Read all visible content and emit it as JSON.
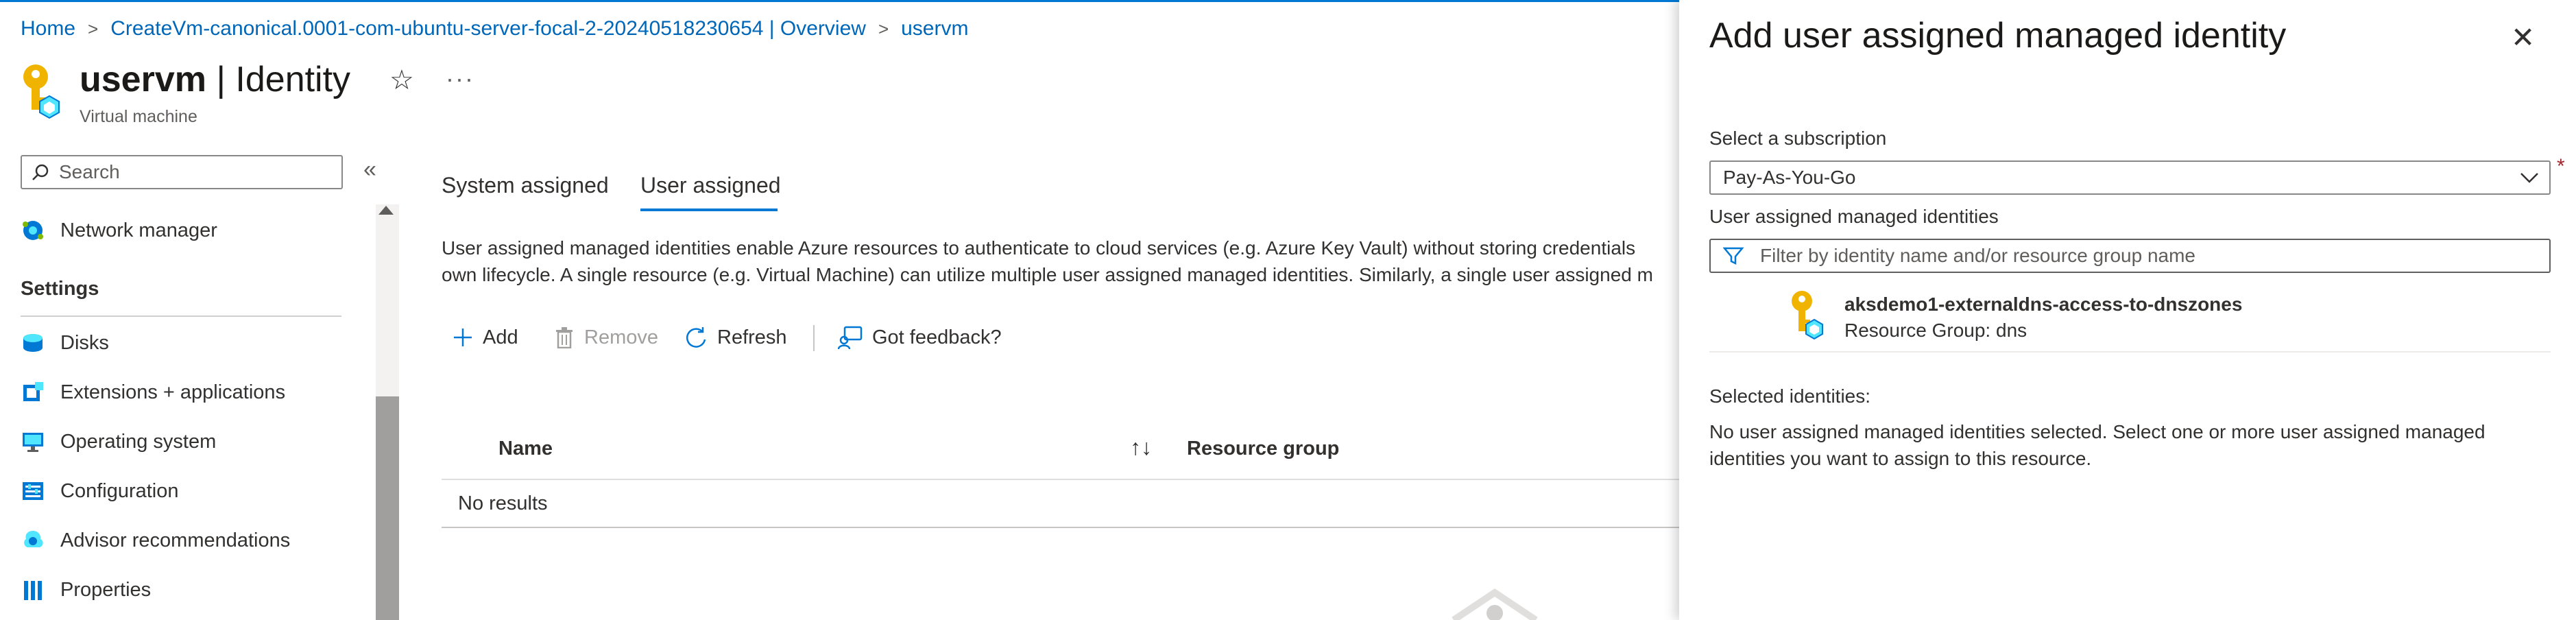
{
  "breadcrumb": [
    "Home",
    "CreateVm-canonical.0001-com-ubuntu-server-focal-2-20240518230654 | Overview",
    "uservm"
  ],
  "header": {
    "resource_name": "uservm",
    "separator": " | ",
    "blade_name": "Identity",
    "subtitle": "Virtual machine",
    "favorite_icon": "star-icon",
    "more_icon": "ellipsis-icon"
  },
  "sidebar": {
    "search_placeholder": "Search",
    "collapse_icon": "double-chevron-left-icon",
    "top_item": {
      "label": "Network manager",
      "icon": "network-manager-icon"
    },
    "section_heading": "Settings",
    "items": [
      {
        "label": "Disks",
        "icon": "disks-icon"
      },
      {
        "label": "Extensions + applications",
        "icon": "extensions-icon"
      },
      {
        "label": "Operating system",
        "icon": "monitor-icon"
      },
      {
        "label": "Configuration",
        "icon": "configuration-icon"
      },
      {
        "label": "Advisor recommendations",
        "icon": "advisor-icon"
      },
      {
        "label": "Properties",
        "icon": "properties-icon"
      }
    ]
  },
  "tabs": [
    {
      "label": "System assigned",
      "selected": false
    },
    {
      "label": "User assigned",
      "selected": true
    }
  ],
  "description": {
    "line1": "User assigned managed identities enable Azure resources to authenticate to cloud services (e.g. Azure Key Vault) without storing credentials",
    "line2": "own lifecycle. A single resource (e.g. Virtual Machine) can utilize multiple user assigned managed identities. Similarly, a single user assigned m"
  },
  "toolbar": {
    "add": "Add",
    "remove": "Remove",
    "refresh": "Refresh",
    "feedback": "Got feedback?"
  },
  "table": {
    "columns": [
      "Name",
      "Resource group"
    ],
    "empty_text": "No results"
  },
  "panel": {
    "title": "Add user assigned managed identity",
    "subscription_label": "Select a subscription",
    "required_mark": "*",
    "subscription_value": "Pay-As-You-Go",
    "identities_label": "User assigned managed identities",
    "filter_placeholder": "Filter by identity name and/or resource group name",
    "identity": {
      "name": "aksdemo1-externaldns-access-to-dnszones",
      "resource_group": "Resource Group: dns"
    },
    "selected_label": "Selected identities:",
    "selected_text": "No user assigned managed identities selected. Select one or more user assigned managed identities you want to assign to this resource."
  },
  "colors": {
    "accent": "#0078d4",
    "link": "#0067b8",
    "key_gold": "#f0b400",
    "required": "#a4262c"
  }
}
